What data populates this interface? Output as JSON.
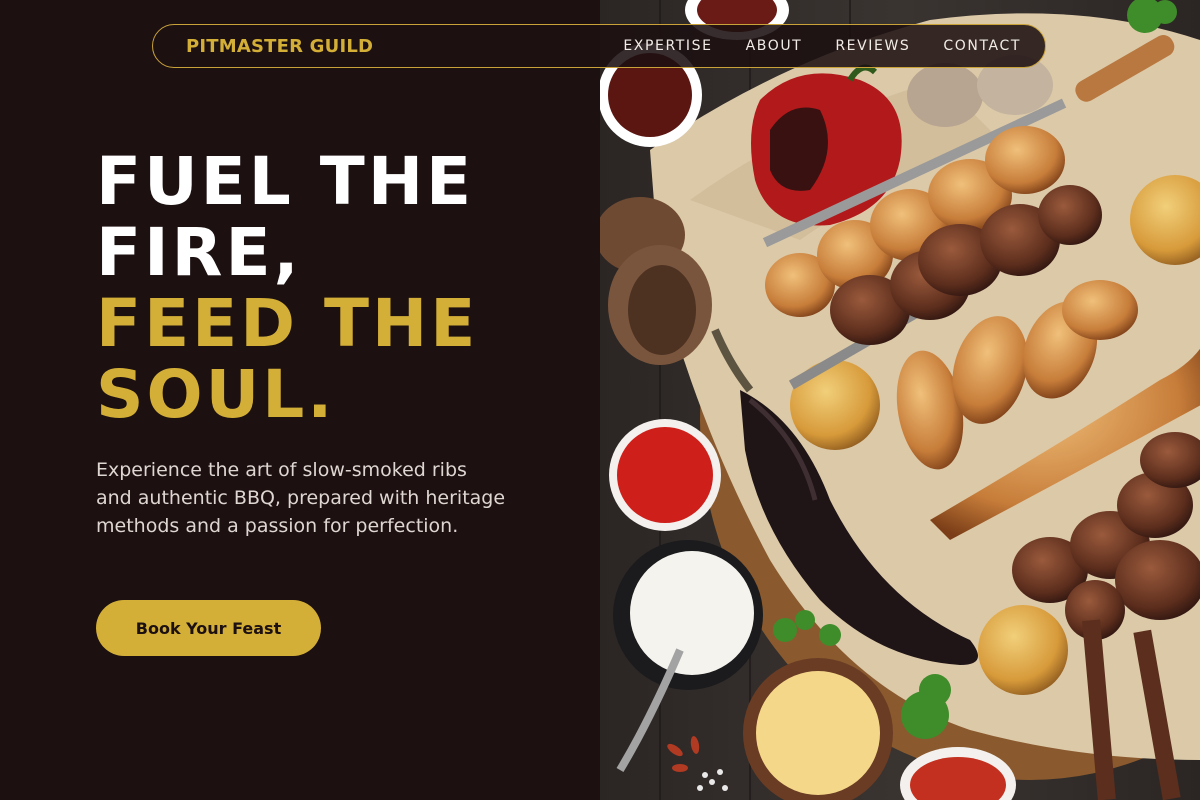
{
  "nav": {
    "brand": "PITMASTER GUILD",
    "links": [
      "EXPERTISE",
      "ABOUT",
      "REVIEWS",
      "CONTACT"
    ]
  },
  "hero": {
    "title_line1": "FUEL THE",
    "title_line2": "FIRE,",
    "title_line3": "FEED THE",
    "title_line4": "SOUL.",
    "subtitle": "Experience the art of slow-smoked ribs and authentic BBQ, prepared with heritage methods and a passion for perfection.",
    "cta_label": "Book Your Feast"
  },
  "image": {
    "subject": "bbq-platter-photo"
  },
  "colors": {
    "background": "#1c1011",
    "accent_gold": "#d4af37",
    "text_white": "#ffffff",
    "text_muted": "#ded6d0"
  }
}
